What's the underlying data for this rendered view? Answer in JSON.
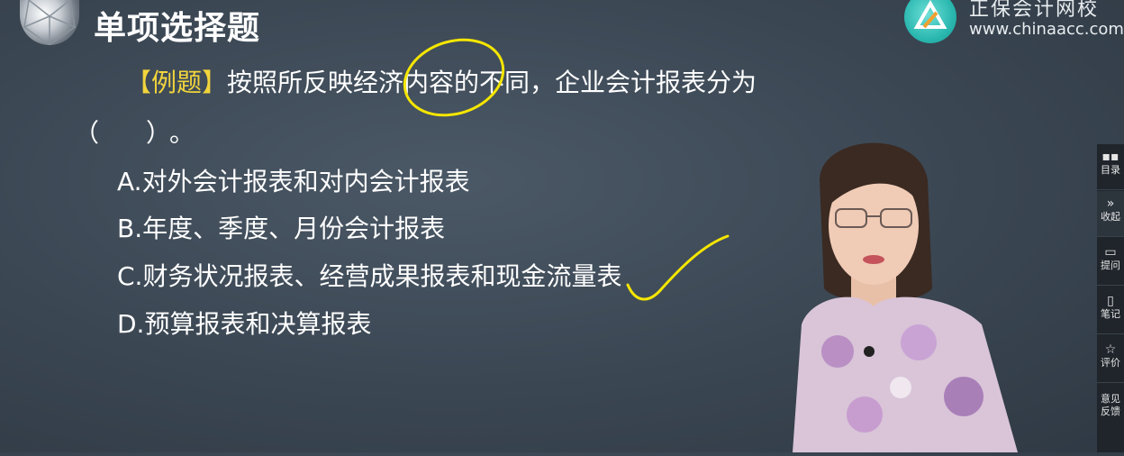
{
  "header": {
    "title": "单项选择题",
    "brand_name": "正保会计网校",
    "brand_url": "www.chinaacc.com"
  },
  "question": {
    "tag": "【例题】",
    "text": "按照所反映经济内容的不同，企业会计报表分为",
    "paren": "（　）。",
    "options": [
      "A.对外会计报表和对内会计报表",
      "B.年度、季度、月份会计报表",
      "C.财务状况报表、经营成果报表和现金流量表",
      "D.预算报表和决算报表"
    ]
  },
  "sidebar": {
    "items": [
      {
        "label": "目录",
        "icon": "grid-icon"
      },
      {
        "label": "收起",
        "icon": "double-chevron-right-icon"
      },
      {
        "label": "提问",
        "icon": "chat-icon"
      },
      {
        "label": "笔记",
        "icon": "note-icon"
      },
      {
        "label": "评价",
        "icon": "star-icon"
      },
      {
        "label": "意见反馈",
        "icon": "feedback-icon"
      }
    ]
  },
  "colors": {
    "background": "#3a4652",
    "highlight_yellow": "#f2d53c",
    "annotation_yellow": "#f5e600",
    "sidebar_bg": "#1f252b",
    "brand_teal": "#2bb8b0"
  }
}
